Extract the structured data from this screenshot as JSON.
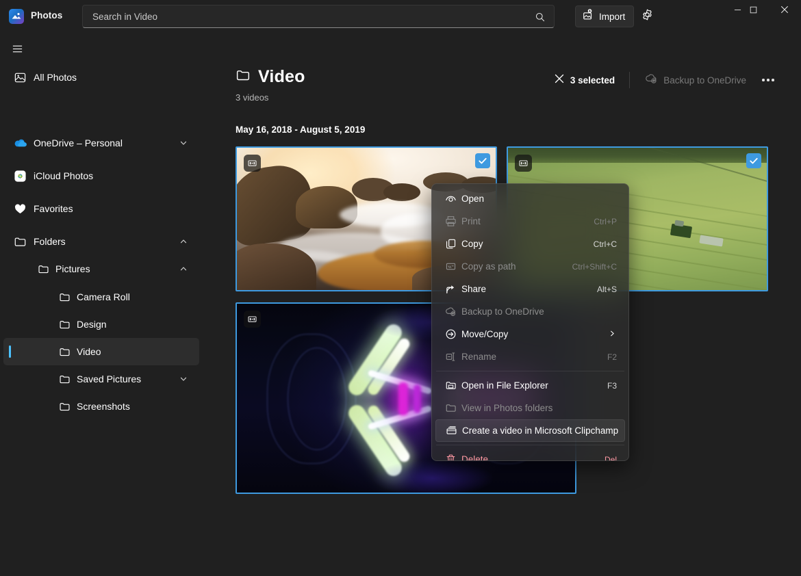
{
  "titlebar": {
    "app_name": "Photos",
    "app_logo_icon": "photos-app-logo",
    "search_placeholder": "Search in Video",
    "search_icon": "search-icon",
    "import_label": "Import",
    "import_icon": "import-image-icon",
    "settings_icon": "gear-icon",
    "minimize_icon": "minimize-icon",
    "maximize_icon": "maximize-icon",
    "close_icon": "close-icon"
  },
  "sidebar": {
    "menu_icon": "hamburger-icon",
    "items": [
      {
        "label": "All Photos",
        "icon": "photo-icon",
        "indent": 0,
        "chevron": "",
        "selected": false
      },
      {
        "label": "OneDrive – Personal",
        "icon": "onedrive-cloud-icon",
        "indent": 0,
        "chevron": "down",
        "selected": false
      },
      {
        "label": "iCloud Photos",
        "icon": "icloud-photos-icon",
        "indent": 0,
        "chevron": "",
        "selected": false
      },
      {
        "label": "Favorites",
        "icon": "heart-icon",
        "indent": 0,
        "chevron": "",
        "selected": false
      },
      {
        "label": "Folders",
        "icon": "folder-icon",
        "indent": 0,
        "chevron": "up",
        "selected": false
      },
      {
        "label": "Pictures",
        "icon": "folder-icon",
        "indent": 1,
        "chevron": "up",
        "selected": false
      },
      {
        "label": "Camera Roll",
        "icon": "folder-icon",
        "indent": 2,
        "chevron": "",
        "selected": false
      },
      {
        "label": "Design",
        "icon": "folder-icon",
        "indent": 2,
        "chevron": "",
        "selected": false
      },
      {
        "label": "Video",
        "icon": "folder-icon",
        "indent": 2,
        "chevron": "",
        "selected": true
      },
      {
        "label": "Saved Pictures",
        "icon": "folder-icon",
        "indent": 2,
        "chevron": "down",
        "selected": false
      },
      {
        "label": "Screenshots",
        "icon": "folder-icon",
        "indent": 2,
        "chevron": "",
        "selected": false
      }
    ]
  },
  "header": {
    "folder_icon": "folder-icon",
    "title": "Video",
    "subtitle": "3 videos",
    "date_range": "May 16, 2018 - August 5, 2019",
    "selection_count": "3 selected",
    "clear_selection_icon": "close-icon",
    "backup_label": "Backup to OneDrive",
    "backup_icon": "cloud-upload-icon",
    "backup_disabled": true,
    "more_icon": "more-horizontal-icon"
  },
  "thumbnails": [
    {
      "name": "ocean-sunset-video",
      "badge_icon": "video-badge-icon",
      "selected": true,
      "check_icon": "check-icon"
    },
    {
      "name": "aerial-tractor-field-video",
      "badge_icon": "video-badge-icon",
      "selected": true,
      "check_icon": "check-icon"
    },
    {
      "name": "neon-abstract-video",
      "badge_icon": "video-badge-icon",
      "selected": true,
      "check_icon": "check-icon"
    }
  ],
  "context_menu": {
    "items": [
      {
        "label": "Open",
        "accel": "",
        "icon": "open-eye-icon",
        "disabled": false,
        "highlighted": false,
        "submenu": false,
        "danger": false,
        "separator_after": false
      },
      {
        "label": "Print",
        "accel": "Ctrl+P",
        "icon": "printer-icon",
        "disabled": true,
        "highlighted": false,
        "submenu": false,
        "danger": false,
        "separator_after": false
      },
      {
        "label": "Copy",
        "accel": "Ctrl+C",
        "icon": "copy-icon",
        "disabled": false,
        "highlighted": false,
        "submenu": false,
        "danger": false,
        "separator_after": false
      },
      {
        "label": "Copy as path",
        "accel": "Ctrl+Shift+C",
        "icon": "copy-path-icon",
        "disabled": true,
        "highlighted": false,
        "submenu": false,
        "danger": false,
        "separator_after": false
      },
      {
        "label": "Share",
        "accel": "Alt+S",
        "icon": "share-icon",
        "disabled": false,
        "highlighted": false,
        "submenu": false,
        "danger": false,
        "separator_after": false
      },
      {
        "label": "Backup to OneDrive",
        "accel": "",
        "icon": "cloud-upload-icon",
        "disabled": true,
        "highlighted": false,
        "submenu": false,
        "danger": false,
        "separator_after": false
      },
      {
        "label": "Move/Copy",
        "accel": "",
        "icon": "move-arrow-icon",
        "disabled": false,
        "highlighted": false,
        "submenu": true,
        "danger": false,
        "separator_after": false
      },
      {
        "label": "Rename",
        "accel": "F2",
        "icon": "rename-icon",
        "disabled": true,
        "highlighted": false,
        "submenu": false,
        "danger": false,
        "separator_after": true
      },
      {
        "label": "Open in File Explorer",
        "accel": "F3",
        "icon": "file-explorer-icon",
        "disabled": false,
        "highlighted": false,
        "submenu": false,
        "danger": false,
        "separator_after": false
      },
      {
        "label": "View in Photos folders",
        "accel": "",
        "icon": "folder-icon",
        "disabled": true,
        "highlighted": false,
        "submenu": false,
        "danger": false,
        "separator_after": false
      },
      {
        "label": "Create a video in Microsoft Clipchamp",
        "accel": "",
        "icon": "clipchamp-icon",
        "disabled": false,
        "highlighted": true,
        "submenu": false,
        "danger": false,
        "separator_after": true
      },
      {
        "label": "Delete",
        "accel": "Del",
        "icon": "trash-icon",
        "disabled": false,
        "highlighted": false,
        "submenu": false,
        "danger": true,
        "separator_after": false
      }
    ]
  },
  "colors": {
    "accent": "#4cc2ff",
    "selection_border": "#3e9ae0",
    "window_bg": "#202020",
    "danger": "#ff99a4"
  }
}
